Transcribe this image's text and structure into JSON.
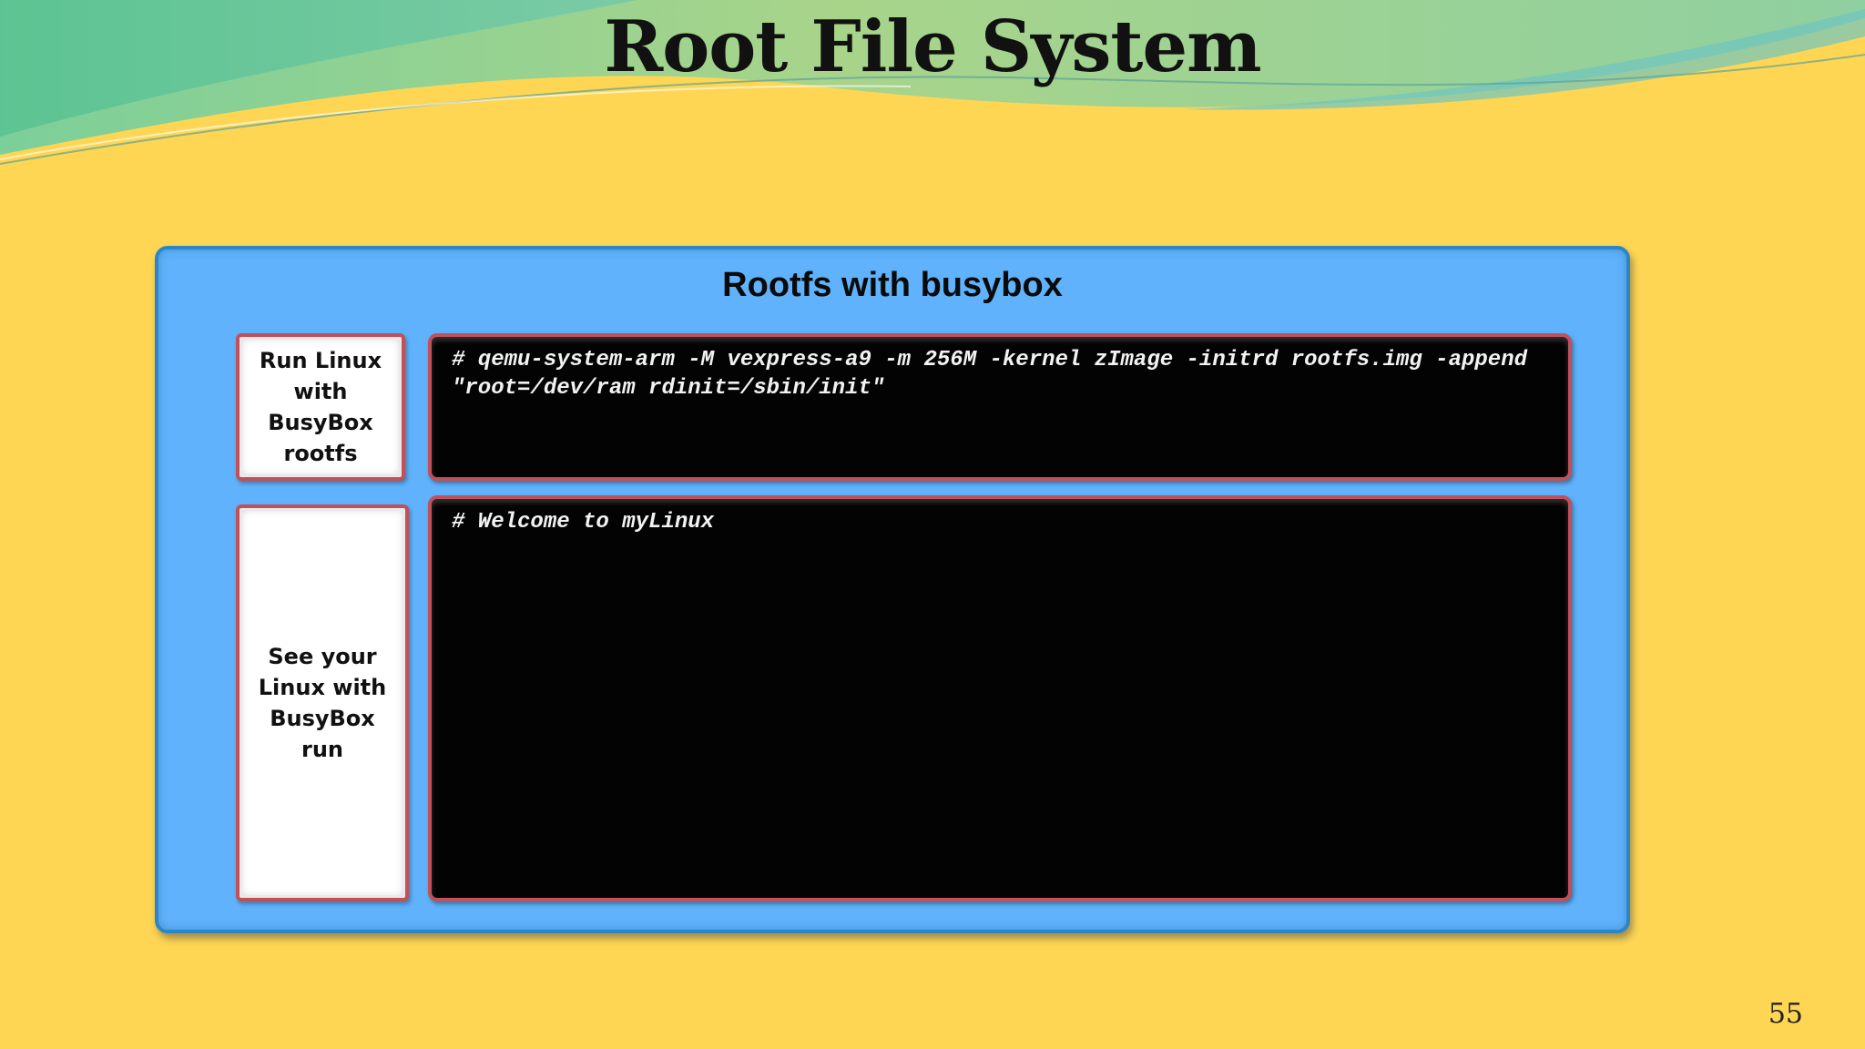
{
  "slide": {
    "title": "Root File System",
    "page_number": "55"
  },
  "panel": {
    "title": "Rootfs with busybox",
    "steps": [
      {
        "label": "Run Linux with BusyBox rootfs",
        "terminal": "# qemu-system-arm -M vexpress-a9 -m 256M -kernel zImage -initrd rootfs.img -append \"root=/dev/ram rdinit=/sbin/init\""
      },
      {
        "label": "See your Linux with BusyBox run",
        "terminal": "# Welcome to myLinux"
      }
    ]
  },
  "colors": {
    "background": "#fed654",
    "panel": "#5fb2fb",
    "box_border": "#c0505a",
    "terminal": "#030303"
  }
}
